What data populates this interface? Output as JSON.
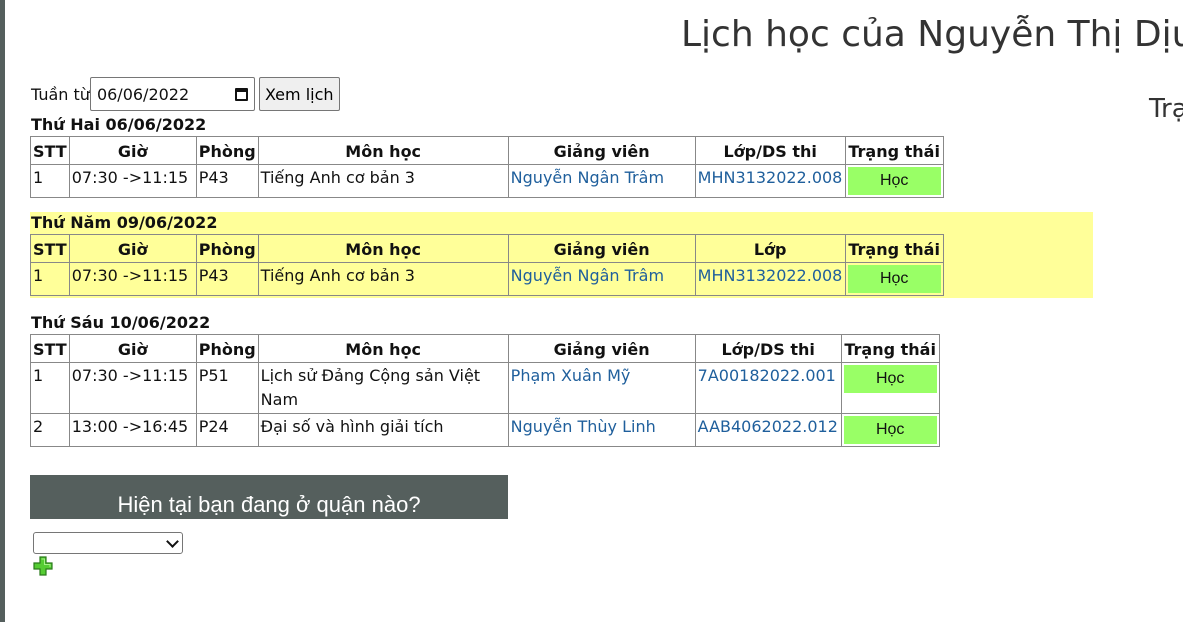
{
  "page": {
    "title": "Lịch học của Nguyễn Thị Dịu",
    "side_text": "Trạ"
  },
  "week_form": {
    "label": "Tuần từ",
    "date_value": "06/06/2022",
    "button_label": "Xem lịch"
  },
  "days": [
    {
      "title": "Thứ Hai 06/06/2022",
      "headers": [
        "STT",
        "Giờ",
        "Phòng",
        "Môn học",
        "Giảng viên",
        "Lớp/DS thi",
        "Trạng thái"
      ],
      "rows": [
        {
          "stt": "1",
          "time": "07:30 ->11:15",
          "room": "P43",
          "subject": "Tiếng Anh cơ bản 3",
          "teacher": "Nguyễn Ngân Trâm",
          "class": "MHN3132022.008",
          "status": "Học"
        }
      ]
    },
    {
      "title": "Thứ Năm 09/06/2022",
      "headers": [
        "STT",
        "Giờ",
        "Phòng",
        "Môn học",
        "Giảng viên",
        "Lớp",
        "Trạng thái"
      ],
      "rows": [
        {
          "stt": "1",
          "time": "07:30 ->11:15",
          "room": "P43",
          "subject": "Tiếng Anh cơ bản 3",
          "teacher": "Nguyễn Ngân Trâm",
          "class": "MHN3132022.008",
          "status": "Học"
        }
      ]
    },
    {
      "title": "Thứ Sáu 10/06/2022",
      "headers": [
        "STT",
        "Giờ",
        "Phòng",
        "Môn học",
        "Giảng viên",
        "Lớp/DS thi",
        "Trạng thái"
      ],
      "rows": [
        {
          "stt": "1",
          "time": "07:30 ->11:15",
          "room": "P51",
          "subject": "Lịch sử Đảng Cộng sản Việt Nam",
          "teacher": "Phạm Xuân Mỹ",
          "class": "7A00182022.001",
          "status": "Học"
        },
        {
          "stt": "2",
          "time": "13:00 ->16:45",
          "room": "P24",
          "subject": "Đại số và hình giải tích",
          "teacher": "Nguyễn Thùy Linh",
          "class": "AAB4062022.012",
          "status": "Học"
        }
      ]
    }
  ],
  "district": {
    "question": "Hiện tại bạn đang ở quận nào?",
    "selected": ""
  },
  "colors": {
    "status_green": "#99ff66",
    "highlight_yellow": "#ffff99",
    "panel_gray": "#555f5d",
    "link_blue": "#1f5f9c"
  },
  "icons": {
    "date_picker": "calendar-icon",
    "select": "chevron-down-icon",
    "add": "plus-icon"
  }
}
